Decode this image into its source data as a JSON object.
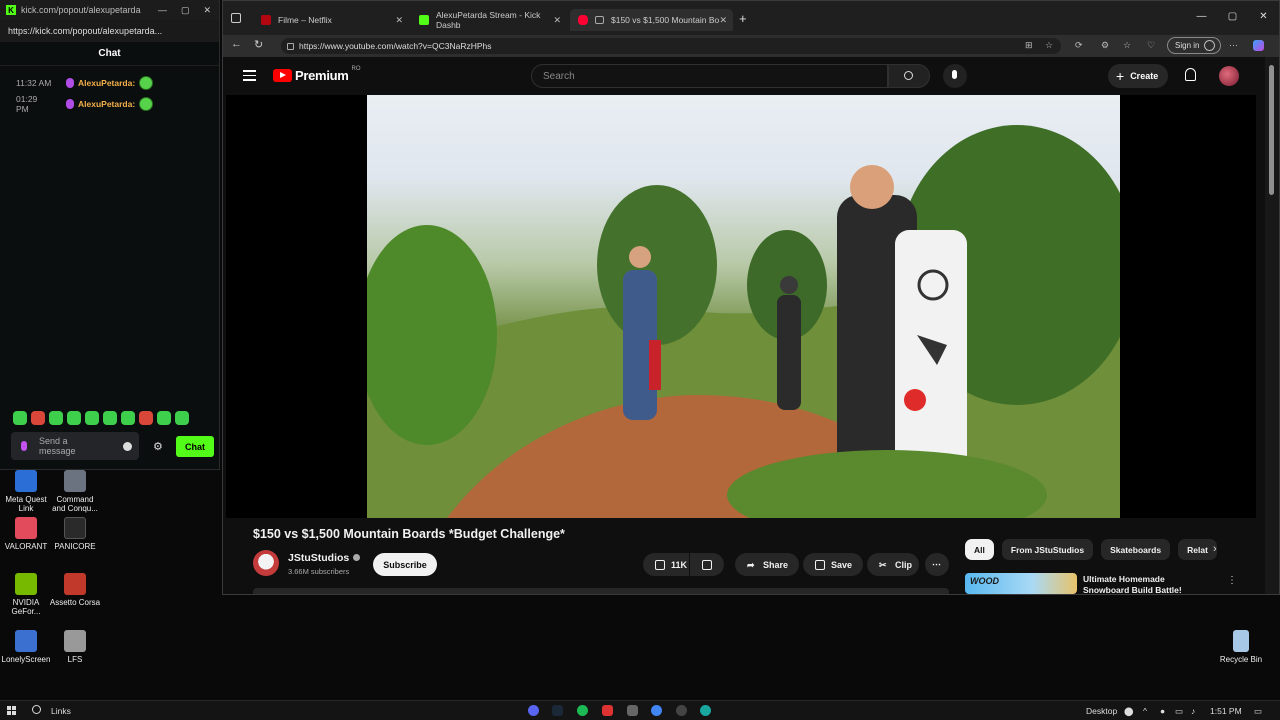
{
  "kick": {
    "title_url": "kick.com/popout/alexupetarda",
    "url": "https://kick.com/popout/alexupetarda...",
    "chat_header": "Chat",
    "messages": [
      {
        "time": "11:32 AM",
        "user": "AlexuPetarda:"
      },
      {
        "time": "01:29 PM",
        "user": "AlexuPetarda:"
      }
    ],
    "send_placeholder": "Send a message",
    "chat_button": "Chat"
  },
  "desktop_icons": [
    {
      "label": "Meta Quest Link",
      "color": "#2b6fd6"
    },
    {
      "label": "Command and Conqu...",
      "color": "#6b7280"
    },
    {
      "label": "VALORANT",
      "color": "#e24b5b"
    },
    {
      "label": "PANICORE",
      "color": "#2a2a2a"
    },
    {
      "label": "NVIDIA GeFor...",
      "color": "#76b900"
    },
    {
      "label": "Assetto Corsa",
      "color": "#c0392b"
    },
    {
      "label": "LonelyScreen",
      "color": "#3b6fd0"
    },
    {
      "label": "LFS",
      "color": "#999999"
    },
    {
      "label": "Recycle Bin",
      "color": "#a8c8e8"
    }
  ],
  "browser": {
    "tabs": [
      {
        "title": "Filme – Netflix",
        "color": "#b20710"
      },
      {
        "title": "AlexuPetarda Stream - Kick Dashb",
        "color": "#53fc18"
      },
      {
        "title": "$150 vs $1,500 Mountain Bo",
        "color": "#ff0033"
      }
    ],
    "url": "https://www.youtube.com/watch?v=QC3NaRzHPhs",
    "sign_in": "Sign in"
  },
  "youtube": {
    "logo_word": "Premium",
    "region": "RO",
    "search_placeholder": "Search",
    "create_label": "Create",
    "video_title": "$150 vs $1,500 Mountain Boards *Budget Challenge*",
    "channel_name": "JStuStudios",
    "subscribers": "3.66M subscribers",
    "subscribe_label": "Subscribe",
    "likes": "11K",
    "share_label": "Share",
    "save_label": "Save",
    "clip_label": "Clip",
    "chips": [
      "All",
      "From JStuStudios",
      "Skateboards",
      "Relat"
    ],
    "recommendation": {
      "thumb_text": "WOOD",
      "title": "Ultimate Homemade Snowboard Build Battle!"
    }
  },
  "taskbar": {
    "links_label": "Links",
    "desktop_label": "Desktop",
    "time": "1:51 PM"
  }
}
